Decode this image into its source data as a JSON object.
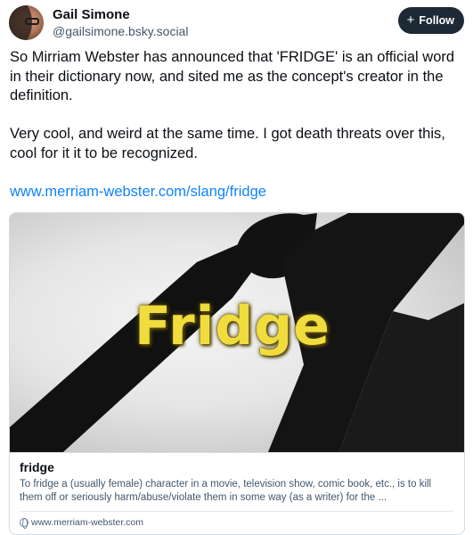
{
  "author": {
    "name": "Gail Simone",
    "handle": "@gailsimone.bsky.social"
  },
  "follow_button": {
    "icon": "+",
    "label": "Follow"
  },
  "post": {
    "paragraph1": "So Mirriam Webster has announced that 'FRIDGE' is an official word in their dictionary now, and sited me as the concept's creator in the definition.",
    "paragraph2": "Very cool, and weird at the same time. I got death threats over this, cool for it it to be recognized.",
    "link_text": "www.merriam-webster.com/slang/fridge"
  },
  "link_card": {
    "image_text": "Fridge",
    "title": "fridge",
    "description": "To fridge a (usually female) character in a movie, television show, comic book, etc., is to kill them off or seriously harm/abuse/violate them in some way (as a writer) for the ...",
    "domain": "www.merriam-webster.com"
  },
  "colors": {
    "link": "#1083fe",
    "follow_bg": "#1e2936",
    "muted_text": "#42576c",
    "fridge_text": "#f0dc3c"
  }
}
